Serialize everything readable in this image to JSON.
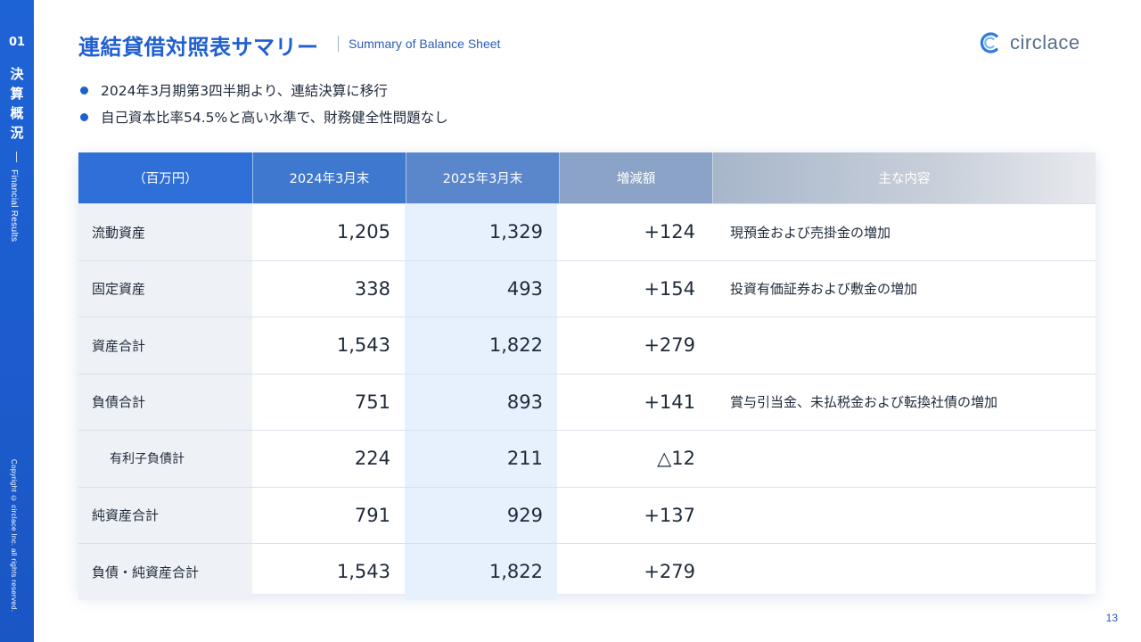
{
  "sidebar": {
    "section_number": "01",
    "section_title_chars": [
      "決",
      "算",
      "概",
      "況"
    ],
    "section_title_en": "Financial Results",
    "copyright": "Copyright © circlace Inc. all rights reserved."
  },
  "header": {
    "title": "連結貸借対照表サマリー",
    "subtitle": "Summary of Balance Sheet",
    "logo_text": "circlace"
  },
  "bullets": [
    "2024年3月期第3四半期より、連結決算に移行",
    "自己資本比率54.5%と高い水準で、財務健全性問題なし"
  ],
  "table": {
    "headers": [
      "（百万円）",
      "2024年3月末",
      "2025年3月末",
      "増減額",
      "主な内容"
    ],
    "rows": [
      {
        "label": "流動資産",
        "v2024": "1,205",
        "v2025": "1,329",
        "diff": "+124",
        "note": "現預金および売掛金の増加",
        "indent": false
      },
      {
        "label": "固定資産",
        "v2024": "338",
        "v2025": "493",
        "diff": "+154",
        "note": "投資有価証券および敷金の増加",
        "indent": false
      },
      {
        "label": "資産合計",
        "v2024": "1,543",
        "v2025": "1,822",
        "diff": "+279",
        "note": "",
        "indent": false
      },
      {
        "label": "負債合計",
        "v2024": "751",
        "v2025": "893",
        "diff": "+141",
        "note": "賞与引当金、未払税金および転換社債の増加",
        "indent": false
      },
      {
        "label": "有利子負債計",
        "v2024": "224",
        "v2025": "211",
        "diff": "△12",
        "note": "",
        "indent": true
      },
      {
        "label": "純資産合計",
        "v2024": "791",
        "v2025": "929",
        "diff": "+137",
        "note": "",
        "indent": false
      },
      {
        "label": "負債・純資産合計",
        "v2024": "1,543",
        "v2025": "1,822",
        "diff": "+279",
        "note": "",
        "indent": false
      }
    ]
  },
  "page_number": "13",
  "colors": {
    "accent": "#1f5fd1",
    "sidebar": "#1e63d6",
    "header_2024": "#3f78cf",
    "header_2025": "#5a86cc",
    "header_diff": "#8aa3c6",
    "col_2025_bg": "#e7f0fd",
    "label_bg": "#eef1f5"
  }
}
